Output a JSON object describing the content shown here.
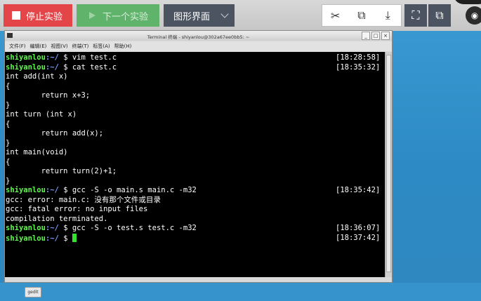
{
  "toolbar": {
    "stop_label": "停止实验",
    "next_label": "下一个实验",
    "gui_label": "图形界面",
    "tool_icons": [
      "scissors-icon",
      "screen-share-icon",
      "download-icon"
    ],
    "fullscreen_icon": "fullscreen-icon",
    "open_external_icon": "open-external-icon",
    "colors": {
      "stop": "#e34548",
      "next": "#5fb36a",
      "gui": "#4b5460"
    }
  },
  "terminal_window": {
    "title": "Terminal 终端 - shiyanlou@302a67ee0bb5: ~",
    "menu": [
      "文件(F)",
      "编辑(E)",
      "视图(V)",
      "终端(T)",
      "标签(A)",
      "帮助(H)"
    ],
    "lines": [
      {
        "type": "prompt",
        "user": "shiyanlou",
        "path": ":~/",
        "cmd": " $ vim test.c",
        "ts": "[18:28:58]"
      },
      {
        "type": "prompt",
        "user": "shiyanlou",
        "path": ":~/",
        "cmd": " $ cat test.c",
        "ts": "[18:35:32]"
      },
      {
        "type": "text",
        "text": "int add(int x)"
      },
      {
        "type": "text",
        "text": "{"
      },
      {
        "type": "text",
        "text": "        return x+3;"
      },
      {
        "type": "text",
        "text": "}"
      },
      {
        "type": "text",
        "text": "int turn (int x)"
      },
      {
        "type": "text",
        "text": "{"
      },
      {
        "type": "text",
        "text": "        return add(x);"
      },
      {
        "type": "text",
        "text": "}"
      },
      {
        "type": "text",
        "text": "int main(void)"
      },
      {
        "type": "text",
        "text": "{"
      },
      {
        "type": "text",
        "text": "        return turn(2)+1;"
      },
      {
        "type": "text",
        "text": "}"
      },
      {
        "type": "prompt",
        "user": "shiyanlou",
        "path": ":~/",
        "cmd": " $ gcc -S -o main.s main.c -m32",
        "ts": "[18:35:42]"
      },
      {
        "type": "text",
        "text": "gcc: error: main.c: 没有那个文件或目录"
      },
      {
        "type": "text",
        "text": "gcc: fatal error: no input files"
      },
      {
        "type": "text",
        "text": "compilation terminated."
      },
      {
        "type": "prompt",
        "user": "shiyanlou",
        "path": ":~/",
        "cmd": " $ gcc -S -o test.s test.c -m32",
        "ts": "[18:36:07]"
      },
      {
        "type": "prompt",
        "user": "shiyanlou",
        "path": ":~/",
        "cmd": " $ ",
        "ts": "[18:37:42]",
        "cursor": true
      }
    ]
  },
  "taskbar": {
    "item": "gedit"
  }
}
